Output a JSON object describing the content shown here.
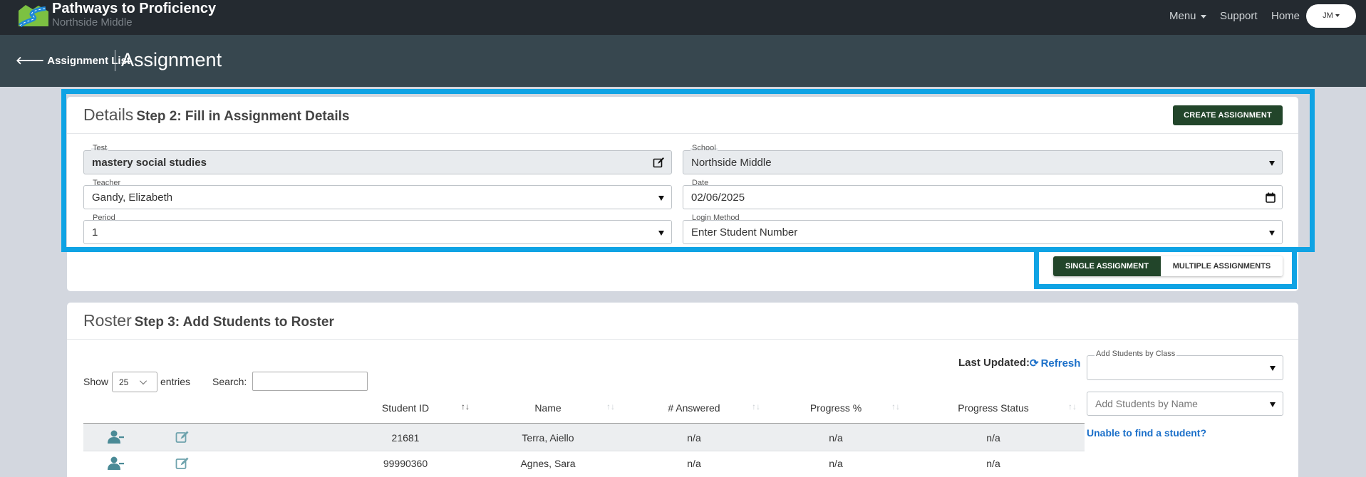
{
  "topbar": {
    "app_title": "Pathways to Proficiency",
    "school_subtitle": "Northside Middle",
    "menu_label": "Menu",
    "support_label": "Support",
    "home_label": "Home",
    "user_initials": "JM",
    "logo_icon": "road-landscape-logo"
  },
  "subheader": {
    "back_label": "Assignment List",
    "back_icon": "arrow-left-icon",
    "page_title": "Assignment"
  },
  "details": {
    "heading": "Details",
    "step": "Step 2: Fill in Assignment Details",
    "create_button": "CREATE ASSIGNMENT",
    "fields": {
      "test": {
        "label": "Test",
        "value": "mastery social studies"
      },
      "school": {
        "label": "School",
        "value": "Northside Middle"
      },
      "teacher": {
        "label": "Teacher",
        "value": "Gandy, Elizabeth"
      },
      "date": {
        "label": "Date",
        "value": "02/06/2025"
      },
      "period": {
        "label": "Period",
        "value": "1"
      },
      "login_method": {
        "label": "Login Method",
        "value": "Enter Student Number"
      }
    },
    "mode_toggle": {
      "single": "SINGLE ASSIGNMENT",
      "multiple": "MULTIPLE ASSIGNMENTS",
      "selected": "single"
    }
  },
  "roster": {
    "heading": "Roster",
    "step": "Step 3: Add Students to Roster",
    "last_updated_label": "Last Updated:",
    "refresh_label": "Refresh",
    "show_label": "Show",
    "entries_value": "25",
    "entries_label": "entries",
    "search_label": "Search:",
    "columns": [
      "Student ID",
      "Name",
      "# Answered",
      "Progress %",
      "Progress Status"
    ],
    "rows": [
      {
        "student_id": "21681",
        "name": "Terra, Aiello",
        "answered": "n/a",
        "progress_pct": "n/a",
        "progress_status": "n/a"
      },
      {
        "student_id": "99990360",
        "name": "Agnes, Sara",
        "answered": "n/a",
        "progress_pct": "n/a",
        "progress_status": "n/a"
      }
    ],
    "add_by_class_label": "Add Students by Class",
    "add_by_name_placeholder": "Add Students by Name",
    "unable_link": "Unable to find a student?"
  },
  "colors": {
    "navbar": "#242a30",
    "subheader": "#37474f",
    "primary_button": "#22452a",
    "highlight": "#0fa3e4",
    "link": "#1a6fc9",
    "icon_teal": "#4a8a96"
  }
}
